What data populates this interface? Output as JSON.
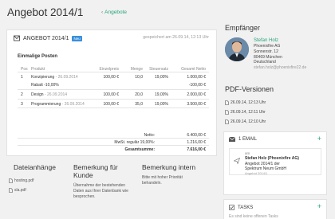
{
  "title": "Angebot 2014/1",
  "back_link": "Angebote",
  "document": {
    "name": "ANGEBOT 2014/1",
    "badge": "Neu",
    "saved": "gespeichert am 26.09.14, 12:13 Uhr",
    "section_title": "Einmalige Posten",
    "columns": [
      "Pos",
      "Produkt",
      "Einzelpreis",
      "Menge",
      "Steuersatz",
      "Gesamt Netto"
    ],
    "rows": [
      {
        "pos": "1",
        "product": "Konzipierung",
        "date": "- 26.09.2014",
        "unit_price": "100,00 €",
        "qty": "10,0",
        "tax": "19,00%",
        "total": "1.000,00 €",
        "discount_label": "Rabatt -10,00%",
        "discount_value": "-100,00 €"
      },
      {
        "pos": "2",
        "product": "Design",
        "date": "- 26.09.2014",
        "unit_price": "100,00 €",
        "qty": "20,0",
        "tax": "19,00%",
        "total": "2.000,00 €"
      },
      {
        "pos": "3",
        "product": "Programmierung",
        "date": "- 26.09.2014",
        "unit_price": "100,00 €",
        "qty": "35,0",
        "tax": "19,00%",
        "total": "3.500,00 €"
      }
    ],
    "netto_label": "Netto:",
    "netto_value": "6.400,00 €",
    "mwst_label": "MwSt. regulär 19,00%:",
    "mwst_value": "1.216,00 €",
    "total_label": "Gesamtsumme:",
    "total_value": "7.616,00 €"
  },
  "attachments": {
    "title": "Dateianhänge",
    "files": [
      "hosting.pdf",
      "sla.pdf"
    ]
  },
  "remark_customer": {
    "title": "Bemerkung für Kunde",
    "text": "Übernahme der bestehenden Daten aus Ihrer Datenbank wie besprochen."
  },
  "remark_internal": {
    "title": "Bemerkung intern",
    "text": "Bitte mit hoher Priorität behandeln."
  },
  "recipient": {
    "heading": "Empfänger",
    "name": "Stefan Holz",
    "company": "Phoenixfire AG",
    "street": "Sonnenstr. 12",
    "city": "80469 München",
    "country": "Deutschland",
    "email": "stefan.holz@phoenixfire22.de"
  },
  "pdf_versions": {
    "heading": "PDF-Versionen",
    "items": [
      "26.09.14, 12:13 Uhr",
      "26.09.14, 12:11 Uhr",
      "26.09.14, 12:10 Uhr"
    ]
  },
  "email_box": {
    "title": "1 EMAIL",
    "plus": "+",
    "am": "am",
    "line1": "Stefan Holz (Phoenixfire AG)",
    "line2": "Angebot 2014/1 der",
    "line3": "Spektrum Neum GmbH",
    "date": "Angebot 2014/1"
  },
  "tasks_box": {
    "title": "TASKS",
    "plus": "+",
    "sub": "Es sind keine offenen Tasks"
  },
  "colors": {
    "accent": "#27a37a",
    "badge": "#3a8fdc"
  }
}
